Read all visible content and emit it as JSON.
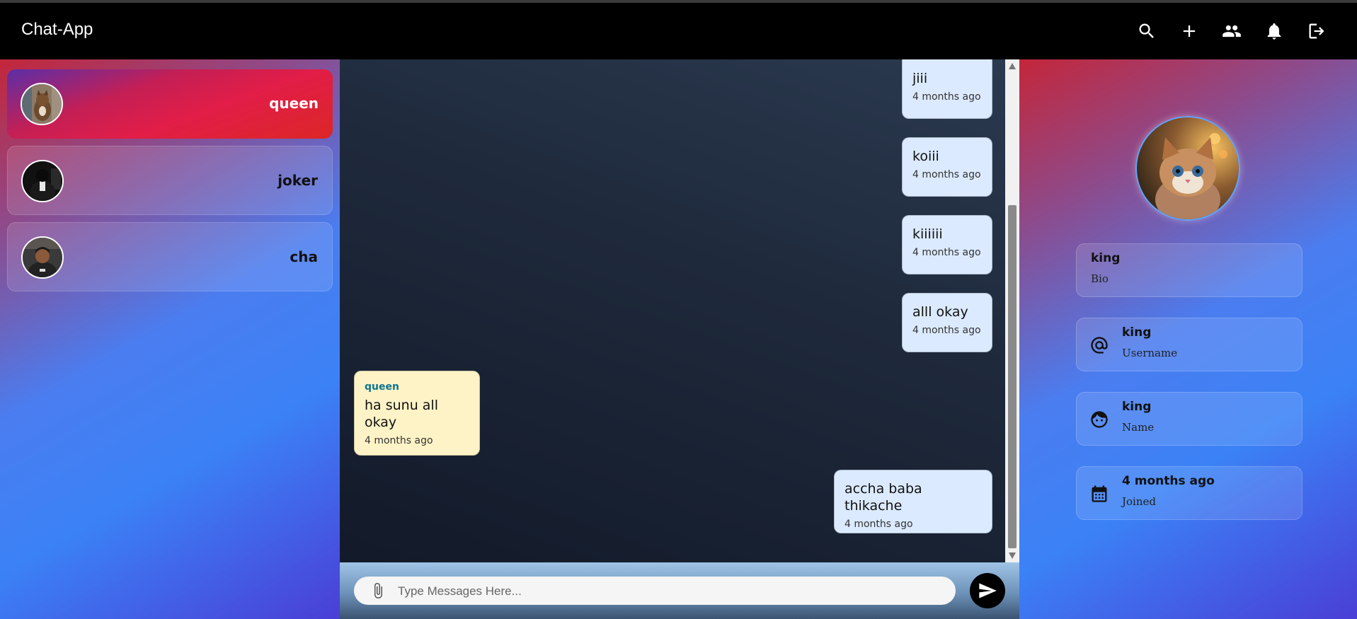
{
  "app": {
    "title": "Chat-App"
  },
  "nav": {
    "icons": [
      "search-icon",
      "add-icon",
      "group-icon",
      "notification-bell-icon",
      "logout-icon"
    ]
  },
  "contacts": [
    {
      "name": "queen",
      "active": true
    },
    {
      "name": "joker",
      "active": false
    },
    {
      "name": "cha",
      "active": false
    }
  ],
  "messages": [
    {
      "direction": "out",
      "text": "jiii",
      "time": "4 months ago"
    },
    {
      "direction": "out",
      "text": "koiii",
      "time": "4 months ago"
    },
    {
      "direction": "out",
      "text": "kiiiiii",
      "time": "4 months ago"
    },
    {
      "direction": "out",
      "text": "alll okay",
      "time": "4 months ago"
    },
    {
      "direction": "in",
      "sender": "queen",
      "text": "ha sunu all okay",
      "time": "4 months ago"
    },
    {
      "direction": "out",
      "text": "accha baba thikache",
      "time": "4 months ago"
    }
  ],
  "composer": {
    "placeholder": "Type Messages Here..."
  },
  "profile": {
    "bio": {
      "title": "king",
      "label": "Bio"
    },
    "username": {
      "title": "king",
      "label": "Username"
    },
    "name": {
      "title": "king",
      "label": "Name"
    },
    "joined": {
      "title": "4 months ago",
      "label": "Joined"
    }
  },
  "colors": {
    "topbar": "#000000",
    "active_contact": "#e11d48",
    "outgoing_bubble": "#dbeafe",
    "incoming_bubble": "#fef3c7",
    "sender_name": "#0e7490"
  }
}
